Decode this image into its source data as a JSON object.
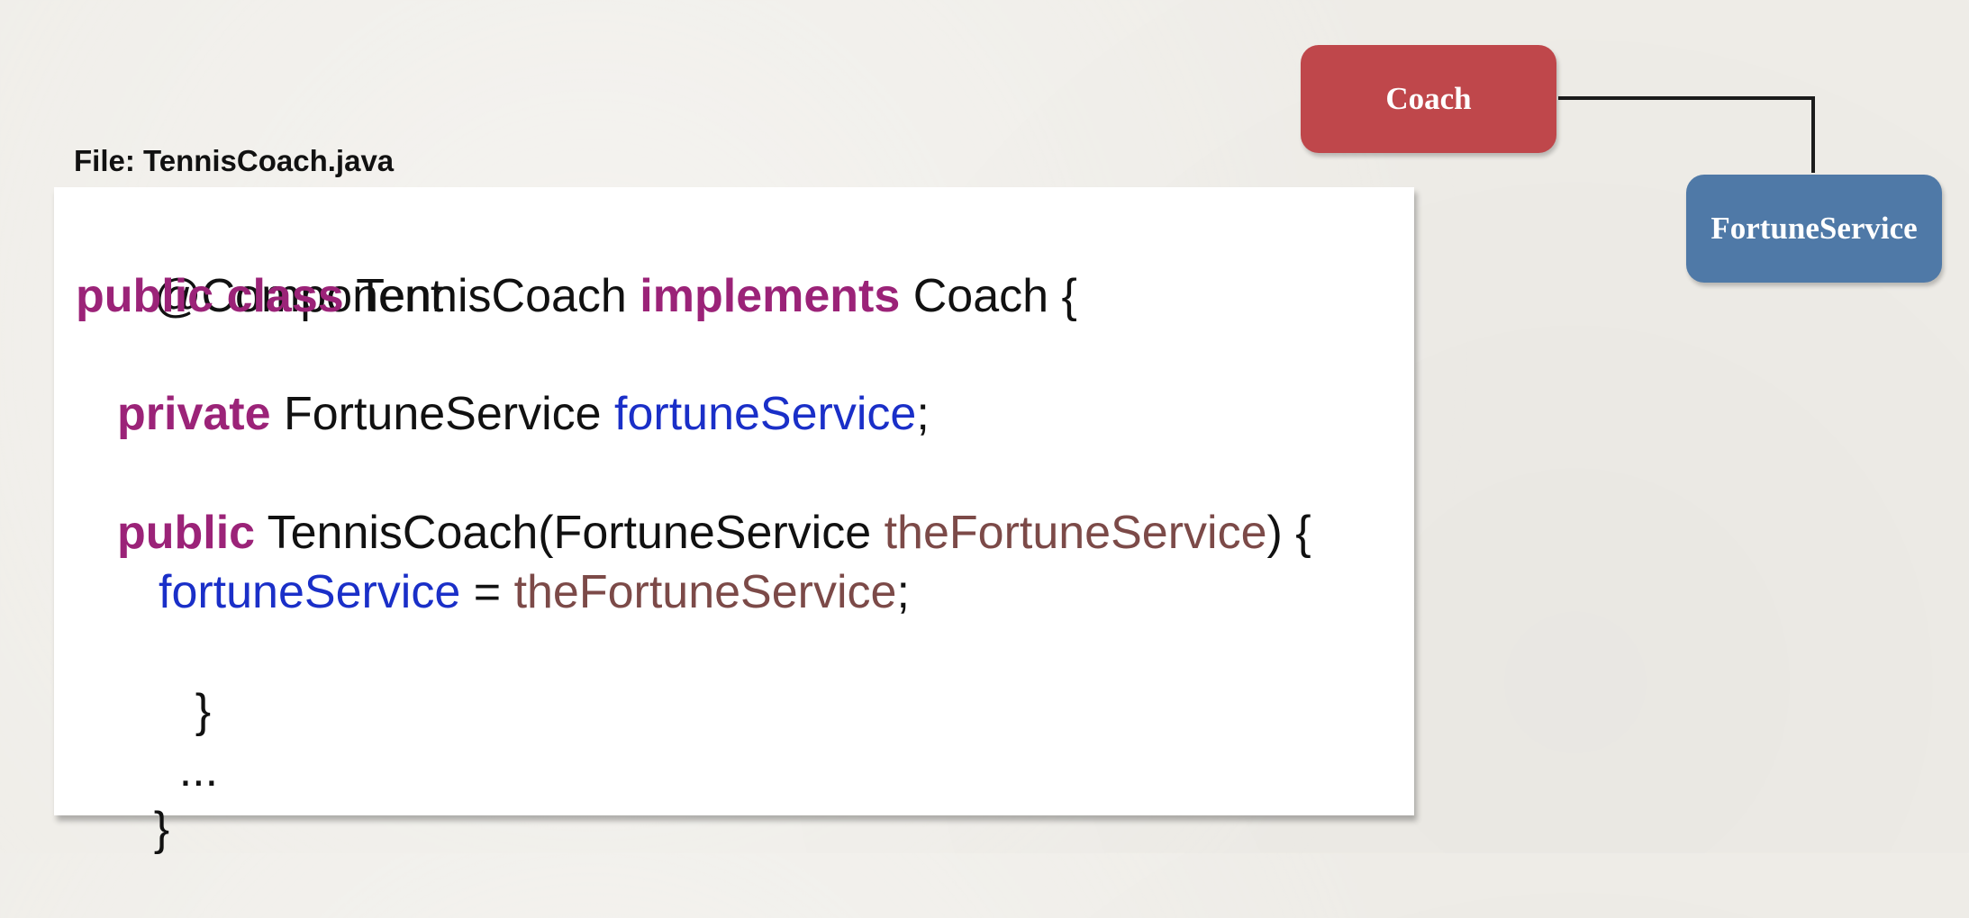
{
  "file_label": "File: TennisCoach.java",
  "code": {
    "line1": "@Component",
    "line2": {
      "public": "public",
      "class": "class",
      "name": " TennisCoach ",
      "implements": "implements",
      "rest": " Coach {"
    },
    "line3": {
      "private": "private",
      "type": " FortuneService ",
      "field": "fortuneService",
      "end": ";"
    },
    "line4": {
      "public": "public",
      "sig": " TennisCoach(FortuneService ",
      "param": "theFortuneService",
      "end": ") {"
    },
    "line5": {
      "field": "fortuneService",
      "eq": " = ",
      "param": "theFortuneService",
      "end": ";"
    },
    "line6": "}",
    "line7": "...",
    "line8": "}"
  },
  "diagram": {
    "coach_label": "Coach",
    "fortune_label": "FortuneService",
    "colors": {
      "coach": "#bf474b",
      "fortune": "#4f79a7",
      "keyword": "#9b2378",
      "field": "#1a2fc8",
      "param": "#7c4a48"
    }
  }
}
